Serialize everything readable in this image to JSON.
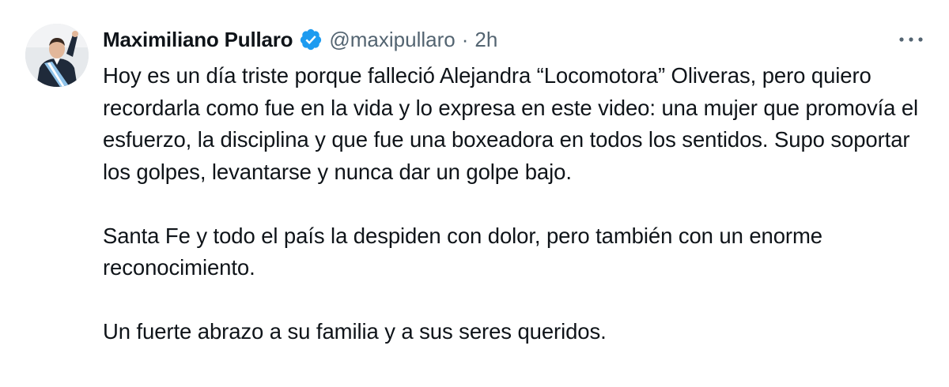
{
  "author": {
    "name": "Maximiliano Pullaro",
    "handle": "@maxipullaro",
    "separator": "·",
    "time": "2h"
  },
  "icons": {
    "verified": "verified-badge-icon",
    "more": "more-options-icon"
  },
  "colors": {
    "verified_blue": "#1d9bf0",
    "secondary_text": "#536471",
    "primary_text": "#0f1419"
  },
  "tweet": {
    "paragraphs": [
      "Hoy es un día triste porque falleció Alejandra “Locomotora” Oliveras, pero quiero recordarla como fue en la vida y lo expresa en este video: una mujer que promovía el esfuerzo, la disciplina y que fue una boxeadora en todos los sentidos. Supo soportar los golpes, levantarse y nunca dar un golpe bajo.",
      "Santa Fe y todo el país la despiden con dolor, pero también con un enorme reconocimiento.",
      "Un fuerte abrazo a su familia y a sus seres queridos."
    ]
  }
}
